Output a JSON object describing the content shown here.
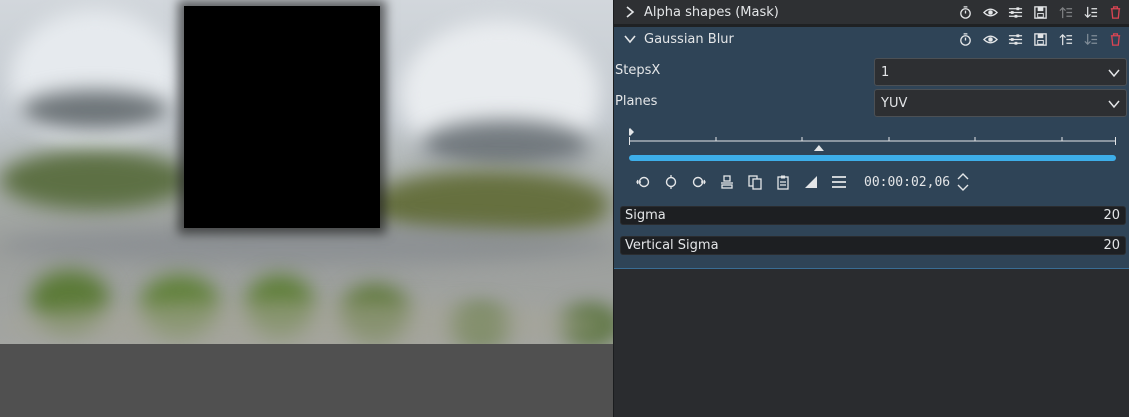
{
  "colors": {
    "panel_bg": "#2a2c2f",
    "effect_selected_bg": "#2f4457",
    "accent": "#3daee9",
    "delete_red": "#da4453",
    "monitor_bg": "#505050",
    "mask_fill": "#000000"
  },
  "monitor": {
    "mask_shape": "black rectangle",
    "icons": []
  },
  "effects": [
    {
      "title": "Alpha shapes (Mask)",
      "expanded": false,
      "header_icons": [
        "timer-icon",
        "eye-icon",
        "sliders-icon",
        "save-icon",
        "move-up-icon",
        "move-down-icon",
        "trash-icon"
      ]
    },
    {
      "title": "Gaussian Blur",
      "expanded": true,
      "header_icons": [
        "timer-icon",
        "eye-icon",
        "sliders-icon",
        "save-icon",
        "move-up-icon",
        "move-down-icon",
        "trash-icon"
      ],
      "params": {
        "stepsx": {
          "label": "StepsX",
          "value": "1"
        },
        "planes": {
          "label": "Planes",
          "value": "YUV"
        }
      },
      "keyframes": {
        "timecode": "00:00:02,06",
        "position_fraction": 0.39,
        "progress_fraction": 1.0,
        "toolbar_icons": [
          "prev-keyframe-icon",
          "add-keyframe-icon",
          "next-keyframe-icon",
          "align-icon",
          "copy-icon",
          "paste-icon",
          "curve-icon",
          "menu-icon"
        ]
      },
      "sliders": {
        "sigma": {
          "label": "Sigma",
          "value": "20"
        },
        "vertical_sigma": {
          "label": "Vertical Sigma",
          "value": "20"
        }
      }
    }
  ]
}
